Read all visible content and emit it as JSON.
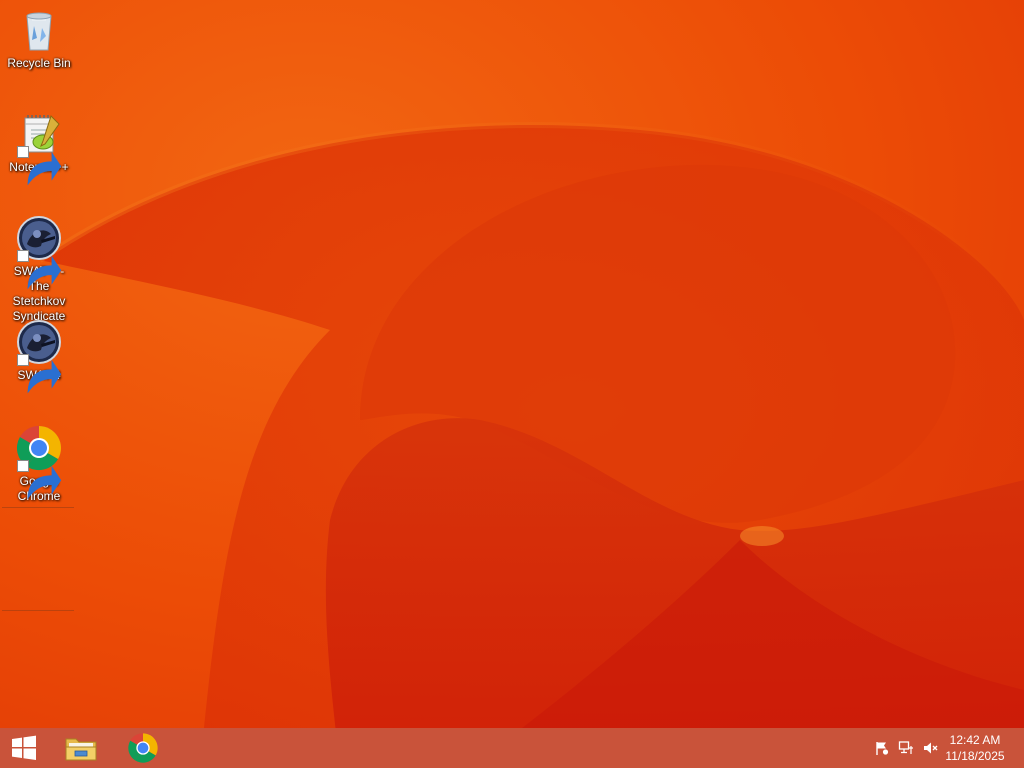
{
  "desktop": {
    "icons": [
      {
        "label": "Recycle Bin",
        "icon": "recycle-bin-icon",
        "shortcut": false
      },
      {
        "label": "Notepad++",
        "icon": "notepad-plus-plus-icon",
        "shortcut": true
      },
      {
        "label": "SWAT 4 - The Stetchkov Syndicate",
        "icon": "swat4-stetchkov-icon",
        "shortcut": true
      },
      {
        "label": "SWAT 4",
        "icon": "swat4-icon",
        "shortcut": true
      },
      {
        "label": "Google Chrome",
        "icon": "chrome-icon",
        "shortcut": true
      }
    ]
  },
  "taskbar": {
    "pinned": [
      {
        "name": "start",
        "icon": "windows-logo-icon"
      },
      {
        "name": "file-explorer",
        "icon": "folder-icon"
      },
      {
        "name": "google-chrome",
        "icon": "chrome-icon"
      }
    ],
    "tray": [
      {
        "name": "action-center",
        "icon": "flag-icon"
      },
      {
        "name": "network",
        "icon": "network-icon"
      },
      {
        "name": "volume",
        "icon": "speaker-muted-icon"
      }
    ],
    "clock": {
      "time": "12:42 AM",
      "date": "11/18/2025"
    }
  },
  "colors": {
    "wallpaper_base": "#ee4a06",
    "wallpaper_deep": "#d81e08",
    "wallpaper_light": "#f06a10",
    "taskbar": "#c9533a",
    "label_text": "#ffffff"
  }
}
